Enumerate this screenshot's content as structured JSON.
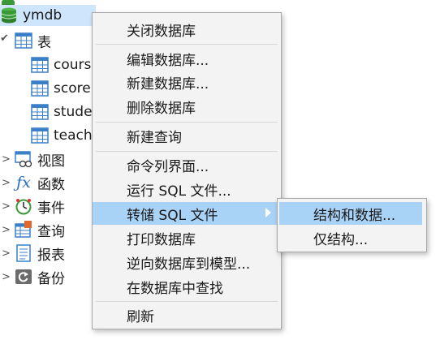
{
  "tree": {
    "db_name": "ymdb",
    "tables_label": "表",
    "tables": [
      "cours",
      "score",
      "stude",
      "teach"
    ],
    "nodes": [
      "视图",
      "函数",
      "事件",
      "查询",
      "报表",
      "备份"
    ]
  },
  "context_menu": {
    "items": [
      "关闭数据库",
      "编辑数据库...",
      "新建数据库...",
      "删除数据库",
      "新建查询",
      "命令列界面...",
      "运行 SQL 文件...",
      "转储 SQL 文件",
      "打印数据库",
      "逆向数据库到模型...",
      "在数据库中查找",
      "刷新"
    ],
    "highlighted_index": 7
  },
  "submenu": {
    "items": [
      "结构和数据...",
      "仅结构..."
    ],
    "highlighted_index": 0
  },
  "colors": {
    "selection": "#cfe5fb",
    "menu_highlight": "#a9d2f7",
    "db_icon": "#3a9a3a",
    "table_icon": "#3c7fc9"
  }
}
